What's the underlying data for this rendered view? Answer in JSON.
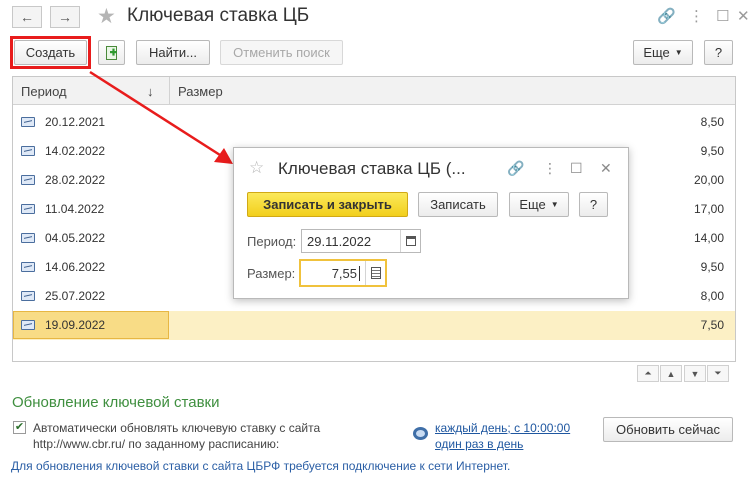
{
  "window": {
    "title": "Ключевая ставка ЦБ",
    "back_icon": "←",
    "forward_icon": "→",
    "star_icon": "★",
    "link_icon": "🔗",
    "more_icon": "⋮",
    "max_icon": "☐",
    "close_icon": "✕"
  },
  "toolbar": {
    "create": "Создать",
    "find": "Найти...",
    "cancel_search": "Отменить поиск",
    "more": "Еще",
    "help": "?"
  },
  "table": {
    "columns": {
      "period": "Период",
      "sort_arrow": "↓",
      "size": "Размер"
    },
    "rows": [
      {
        "date": "20.12.2021",
        "value": "8,50"
      },
      {
        "date": "14.02.2022",
        "value": "9,50"
      },
      {
        "date": "28.02.2022",
        "value": "20,00"
      },
      {
        "date": "11.04.2022",
        "value": "17,00"
      },
      {
        "date": "04.05.2022",
        "value": "14,00"
      },
      {
        "date": "14.06.2022",
        "value": "9,50"
      },
      {
        "date": "25.07.2022",
        "value": "8,00"
      },
      {
        "date": "19.09.2022",
        "value": "7,50"
      }
    ],
    "selected_index": 7
  },
  "scroll": {
    "top": "⏶",
    "up": "▲",
    "down": "▼",
    "bottom": "⏷"
  },
  "update_section": {
    "title": "Обновление ключевой ставки",
    "checkbox_checked": true,
    "checkbox_mark": "✔",
    "auto_line1": "Автоматически обновлять ключевую ставку с сайта",
    "auto_line2": "http://www.cbr.ru/ по заданному расписанию:",
    "schedule_line1": "каждый день; с 10:00:00",
    "schedule_line2": "один раз в день",
    "update_now": "Обновить сейчас",
    "info": "Для обновления ключевой ставки с сайта ЦБРФ требуется подключение к сети Интернет."
  },
  "dialog": {
    "title": "Ключевая ставка ЦБ (...",
    "save_close": "Записать и закрыть",
    "save": "Записать",
    "more": "Еще",
    "help": "?",
    "period_label": "Период:",
    "period_value": "29.11.2022",
    "size_label": "Размер:",
    "size_value": "7,55"
  },
  "colors": {
    "annotation": "#e81c1c",
    "section_green": "#3f8f3f",
    "link_blue": "#1f57a0",
    "primary_yellow": "#f2cf1c"
  }
}
